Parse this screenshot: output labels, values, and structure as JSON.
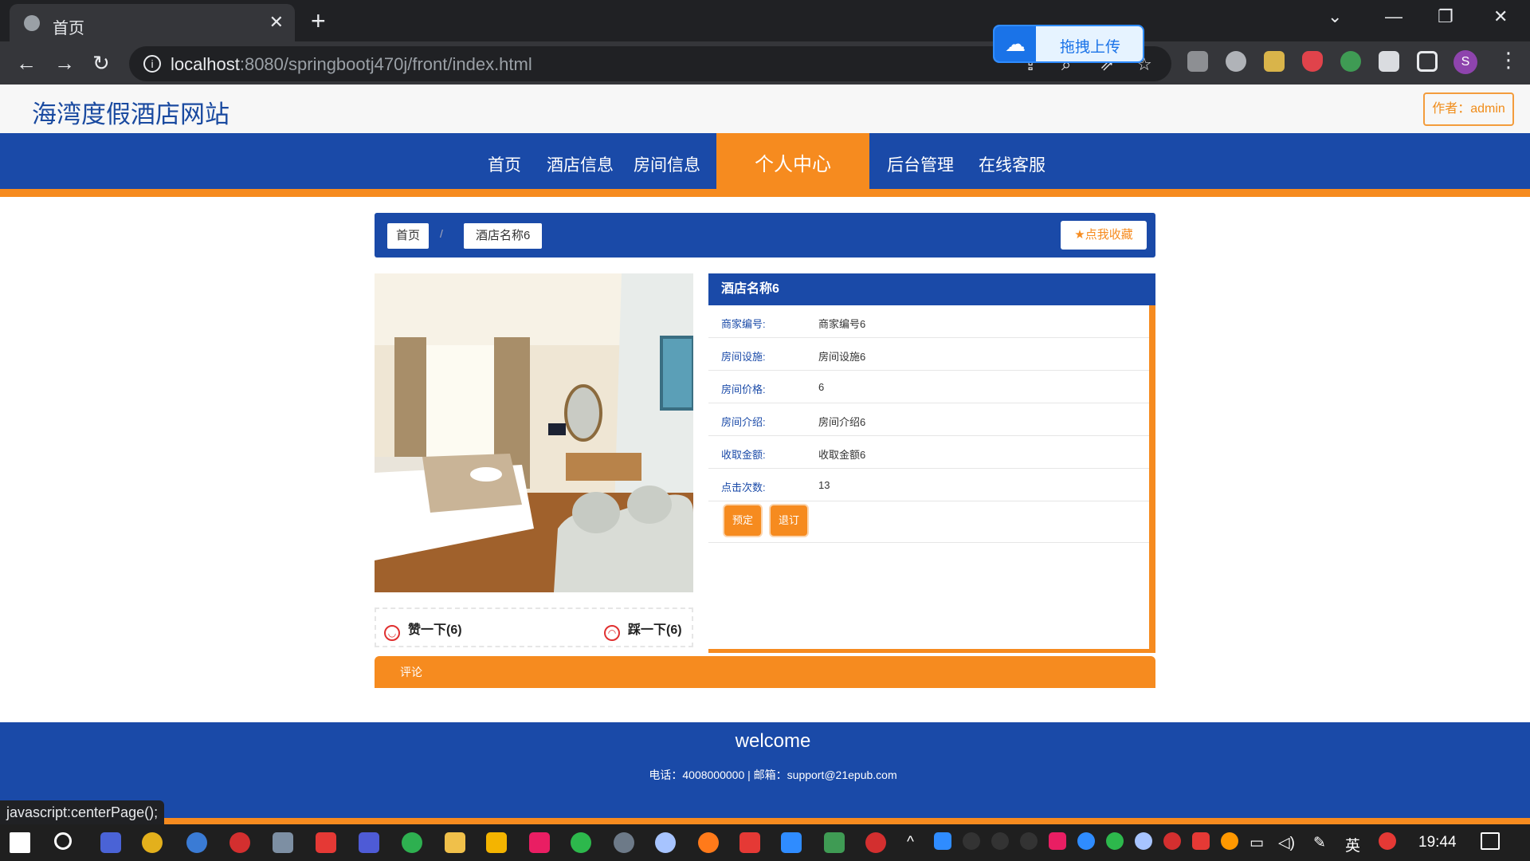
{
  "browser": {
    "tab_title": "首页",
    "url_host": "localhost",
    "url_rest": ":8080/springbootj470j/front/index.html",
    "baidu_upload": "拖拽上传",
    "profile_initial": "S",
    "status_text": "javascript:centerPage();"
  },
  "site": {
    "title": "海湾度假酒店网站",
    "author": "作者：admin"
  },
  "nav": {
    "home": "首页",
    "hotel": "酒店信息",
    "room": "房间信息",
    "profile": "个人中心",
    "admin": "后台管理",
    "service": "在线客服"
  },
  "breadcrumb": {
    "home": "首页",
    "sep": "/",
    "current": "酒店名称6",
    "favorite": "点我收藏"
  },
  "detail": {
    "title": "酒店名称6",
    "fields": [
      {
        "label": "商家编号:",
        "value": "商家编号6"
      },
      {
        "label": "房间设施:",
        "value": "房间设施6"
      },
      {
        "label": "房间价格:",
        "value": "6"
      },
      {
        "label": "房间介绍:",
        "value": "房间介绍6"
      },
      {
        "label": "收取金额:",
        "value": "收取金额6"
      },
      {
        "label": "点击次数:",
        "value": "13"
      }
    ],
    "book": "预定",
    "cancel": "退订"
  },
  "reactions": {
    "like": "赞一下(6)",
    "dislike": "踩一下(6)"
  },
  "comment": "评论",
  "footer": {
    "welcome": "welcome",
    "contact": "电话：4008000000 | 邮箱：support@21epub.com"
  },
  "taskbar": {
    "ime": "英",
    "time": "19:44"
  }
}
